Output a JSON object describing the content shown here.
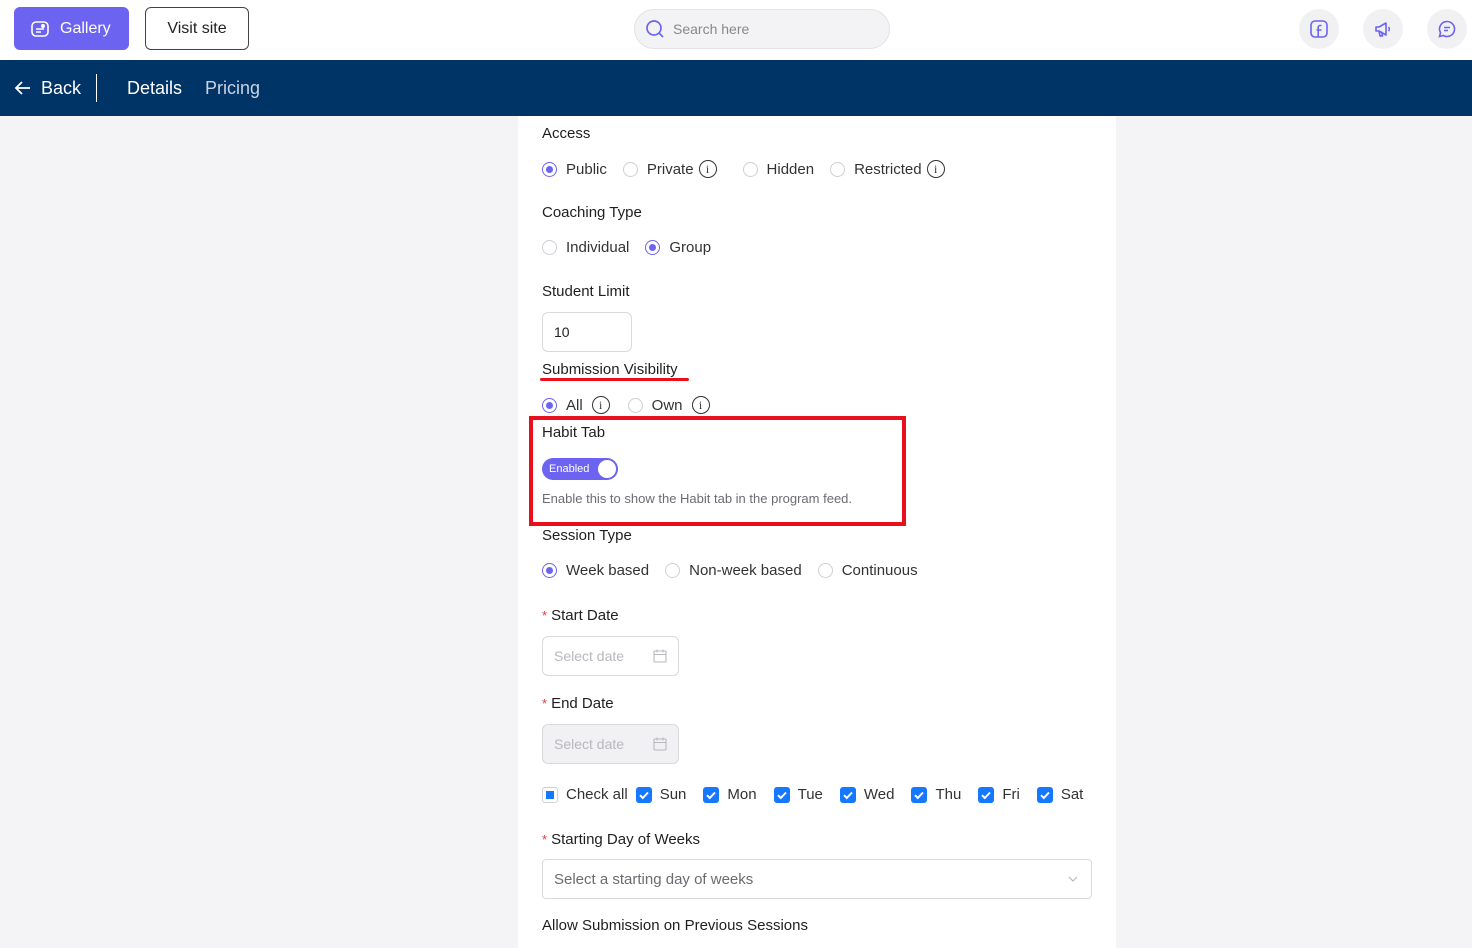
{
  "header": {
    "gallery_label": "Gallery",
    "visit_site_label": "Visit site",
    "search_placeholder": "Search here"
  },
  "nav": {
    "back_label": "Back",
    "tabs": [
      "Details",
      "Pricing"
    ]
  },
  "form": {
    "access": {
      "label": "Access",
      "options": [
        "Public",
        "Private",
        "Hidden",
        "Restricted"
      ],
      "selected": "Public"
    },
    "coaching_type": {
      "label": "Coaching Type",
      "options": [
        "Individual",
        "Group"
      ],
      "selected": "Group"
    },
    "student_limit": {
      "label": "Student Limit",
      "value": "10"
    },
    "submission_visibility": {
      "label": "Submission Visibility",
      "options": [
        "All",
        "Own"
      ],
      "selected": "All"
    },
    "habit_tab": {
      "label": "Habit Tab",
      "toggle_label": "Enabled",
      "enabled": true,
      "hint": "Enable this to show the Habit tab in the program feed."
    },
    "session_type": {
      "label": "Session Type",
      "options": [
        "Week based",
        "Non-week based",
        "Continuous"
      ],
      "selected": "Week based"
    },
    "start_date": {
      "label": "Start Date",
      "required_mark": "*",
      "placeholder": "Select date"
    },
    "end_date": {
      "label": "End Date",
      "required_mark": "*",
      "placeholder": "Select date"
    },
    "days": {
      "check_all_label": "Check all",
      "items": [
        "Sun",
        "Mon",
        "Tue",
        "Wed",
        "Thu",
        "Fri",
        "Sat"
      ]
    },
    "starting_day": {
      "label": "Starting Day of Weeks",
      "required_mark": "*",
      "placeholder": "Select a starting day of weeks"
    },
    "allow_submission": {
      "label": "Allow Submission on Previous Sessions"
    }
  },
  "colors": {
    "accent": "#6c63f0",
    "nav_bg": "#003366",
    "highlight": "#e8101a",
    "checkbox": "#1677ff"
  }
}
